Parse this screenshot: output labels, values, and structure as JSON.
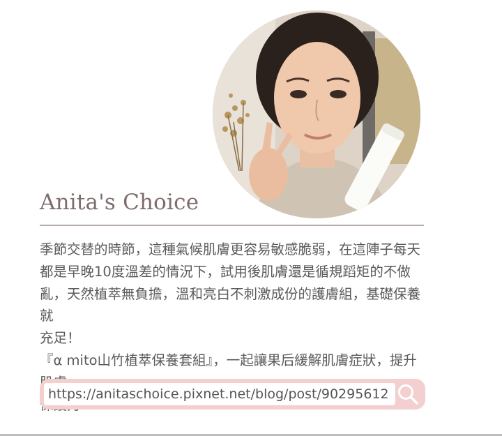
{
  "card": {
    "title": "Anita's Choice",
    "paragraph_lines": [
      "季節交替的時節，這種氣候肌膚更容易敏感脆弱，在這陣子每天",
      "都是早晚10度溫差的情況下，試用後肌膚還是循規蹈矩的不做",
      "亂，天然植萃無負擔，溫和亮白不刺激成份的護膚組，基礎保養就",
      "充足！",
      "『α mito山竹植萃保養套組』，一起讓果后緩解肌膚症狀，提升肌膚",
      "保護力~"
    ],
    "search": {
      "value": "https://anitaschoice.pixnet.net/blog/post/90295612",
      "icon": "search-icon"
    }
  },
  "colors": {
    "title": "#7f6d6d",
    "rule": "#b9acac",
    "search_bg": "#f4cfcf",
    "search_icon": "#ffffff",
    "body_text": "#5a5a5a"
  }
}
